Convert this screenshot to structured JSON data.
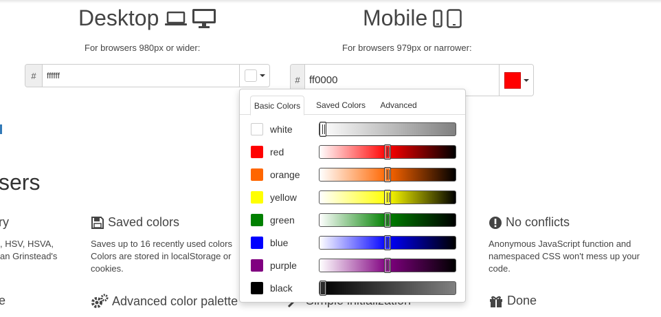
{
  "desktop": {
    "title": "Desktop",
    "subtitle": "For browsers 980px or wider:",
    "hash": "#",
    "value": "ffffff",
    "swatch_color": "#ffffff"
  },
  "mobile": {
    "title": "Mobile",
    "subtitle": "For browsers 979px or narrower:",
    "hash": "#",
    "value": "ff0000",
    "swatch_color": "#ff0000"
  },
  "left_fragments": {
    "heading": "sers",
    "col1_title": "ry",
    "col1_lines": [
      ", HSV, HSVA,",
      "an Grinstead's"
    ],
    "col1_bottom": "e"
  },
  "features": {
    "saved_colors": {
      "title": "Saved colors",
      "lines": [
        "Saves up to 16 recently used colors",
        "Colors are stored in localStorage or",
        "cookies."
      ]
    },
    "no_conflicts": {
      "title": "No conflicts",
      "lines": [
        "Anonymous JavaScript function and",
        "namespaced CSS won't mess up your",
        "code."
      ]
    },
    "advanced_palette": {
      "title": "Advanced color palette"
    },
    "simple_init": {
      "title": "Simple initialization"
    },
    "done": {
      "title": "Done"
    }
  },
  "picker": {
    "tabs": [
      "Basic Colors",
      "Saved Colors",
      "Advanced"
    ],
    "active_tab": "Basic Colors",
    "colors": [
      {
        "name": "white",
        "hex": "#ffffff",
        "level": 0.0
      },
      {
        "name": "red",
        "hex": "#ff0000",
        "level": 0.5
      },
      {
        "name": "orange",
        "hex": "#ff6600",
        "level": 0.5
      },
      {
        "name": "yellow",
        "hex": "#ffff00",
        "level": 0.5
      },
      {
        "name": "green",
        "hex": "#008000",
        "level": 0.5
      },
      {
        "name": "blue",
        "hex": "#0000ff",
        "level": 0.5
      },
      {
        "name": "purple",
        "hex": "#800080",
        "level": 0.5
      },
      {
        "name": "black",
        "hex": "#000000",
        "level": 0.0
      }
    ]
  }
}
